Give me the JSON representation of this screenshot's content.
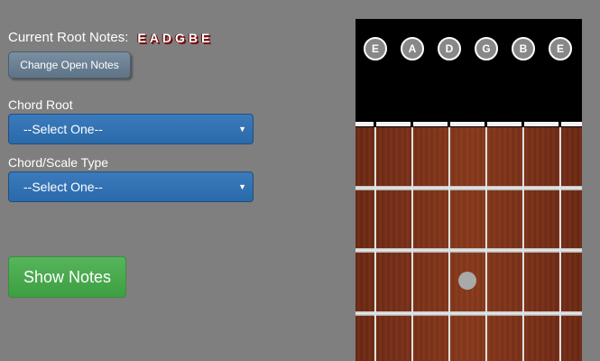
{
  "header": {
    "root_label": "Current Root Notes:",
    "root_notes": [
      "E",
      "A",
      "D",
      "G",
      "B",
      "E"
    ],
    "change_button": "Change Open Notes"
  },
  "chord_root": {
    "label": "Chord Root",
    "selected": "--Select One--"
  },
  "chord_type": {
    "label": "Chord/Scale Type",
    "selected": "--Select One--"
  },
  "show_button": "Show Notes",
  "fretboard": {
    "open_notes": [
      "E",
      "A",
      "D",
      "G",
      "B",
      "E"
    ],
    "markers": [
      {
        "fret": 3,
        "between_strings": [
          3,
          4
        ]
      }
    ]
  },
  "colors": {
    "background": "#7f7f7f",
    "select_blue": "#2a6aa9",
    "show_green": "#3e9e42",
    "change_slate": "#5d7386"
  }
}
